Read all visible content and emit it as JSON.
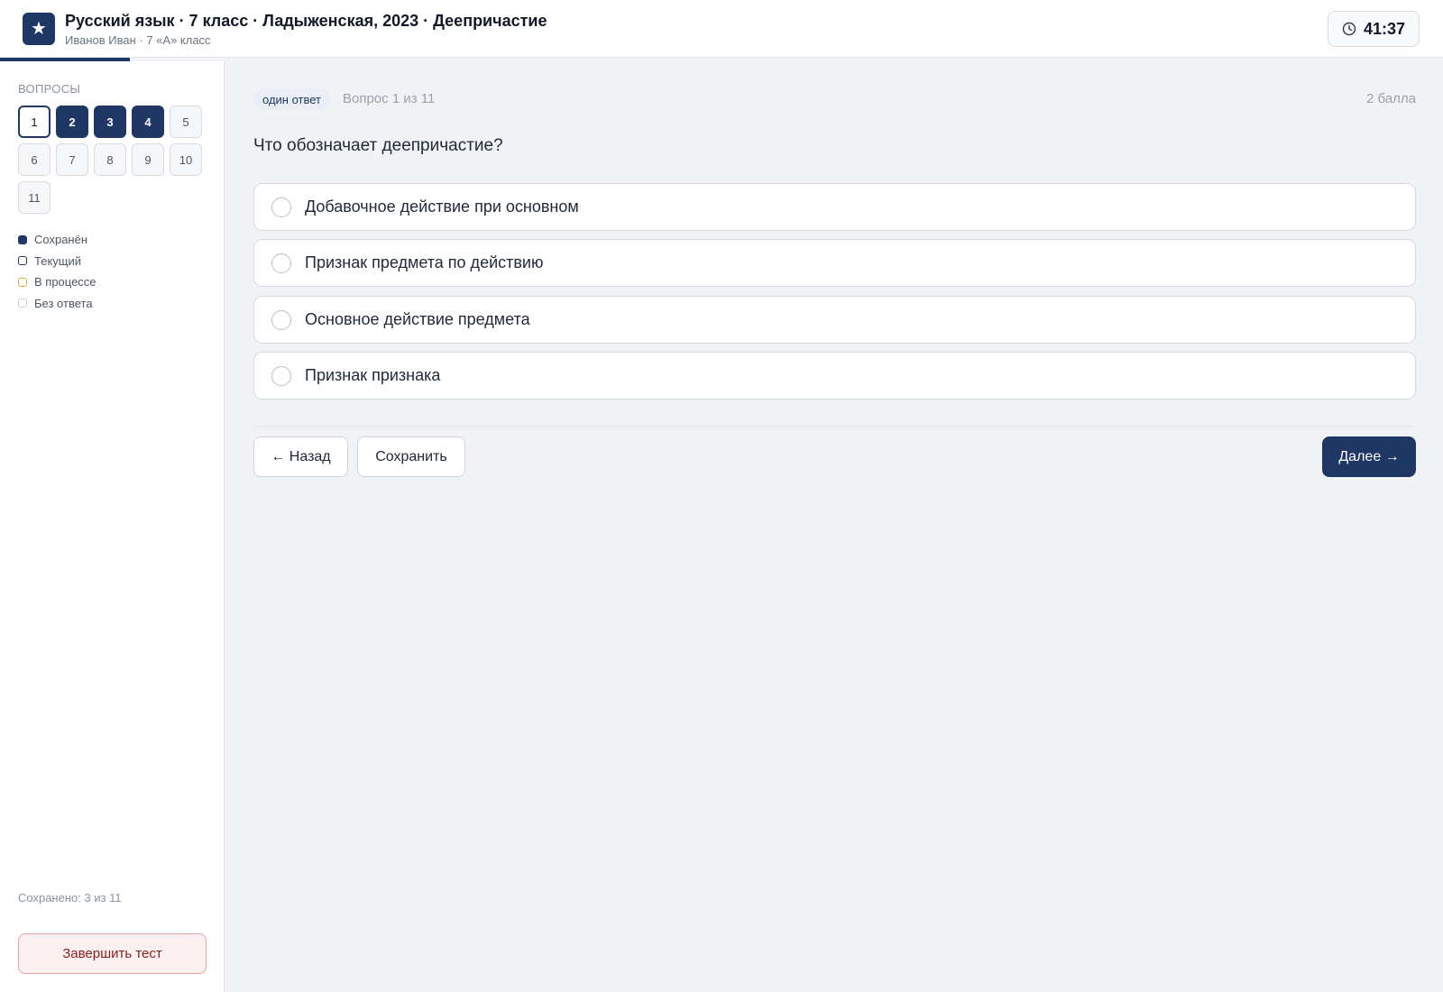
{
  "header": {
    "title": "Русский язык · 7 класс · Ладыженская, 2023 · Деепричастие",
    "subtitle": "Иванов Иван · 7 «А» класс",
    "logo_glyph": "★",
    "timer": "41:37"
  },
  "sidebar": {
    "heading": "ВОПРОСЫ",
    "questions": [
      {
        "label": "1",
        "state": "current"
      },
      {
        "label": "2",
        "state": "saved"
      },
      {
        "label": "3",
        "state": "saved"
      },
      {
        "label": "4",
        "state": "saved"
      },
      {
        "label": "5",
        "state": "unanswered"
      },
      {
        "label": "6",
        "state": "unanswered"
      },
      {
        "label": "7",
        "state": "unanswered"
      },
      {
        "label": "8",
        "state": "unanswered"
      },
      {
        "label": "9",
        "state": "unanswered"
      },
      {
        "label": "10",
        "state": "unanswered"
      },
      {
        "label": "11",
        "state": "unanswered"
      }
    ],
    "legend": [
      {
        "label": "Сохранён",
        "color": "#1f3764",
        "style": "filled"
      },
      {
        "label": "Текущий",
        "color": "#1f3764",
        "style": "outline"
      },
      {
        "label": "В процессе",
        "color": "#e8a93a",
        "style": "outline"
      },
      {
        "label": "Без ответа",
        "color": "#c8cdd4",
        "style": "outline"
      }
    ],
    "saved_count": "Сохранено: 3 из 11",
    "finish_label": "Завершить тест"
  },
  "question": {
    "type_badge": "один ответ",
    "counter": "Вопрос 1 из 11",
    "points": "2 балла",
    "text": "Что обозначает деепричастие?",
    "options": [
      "Добавочное действие при основном",
      "Признак предмета по действию",
      "Основное действие предмета",
      "Признак признака"
    ]
  },
  "nav": {
    "back_label": "← Назад",
    "save_label": "Сохранить",
    "next_label": "Далее →"
  },
  "colors": {
    "accent": "#1f3764",
    "background": "#f0f2f6",
    "danger": "#8b1d1d"
  }
}
